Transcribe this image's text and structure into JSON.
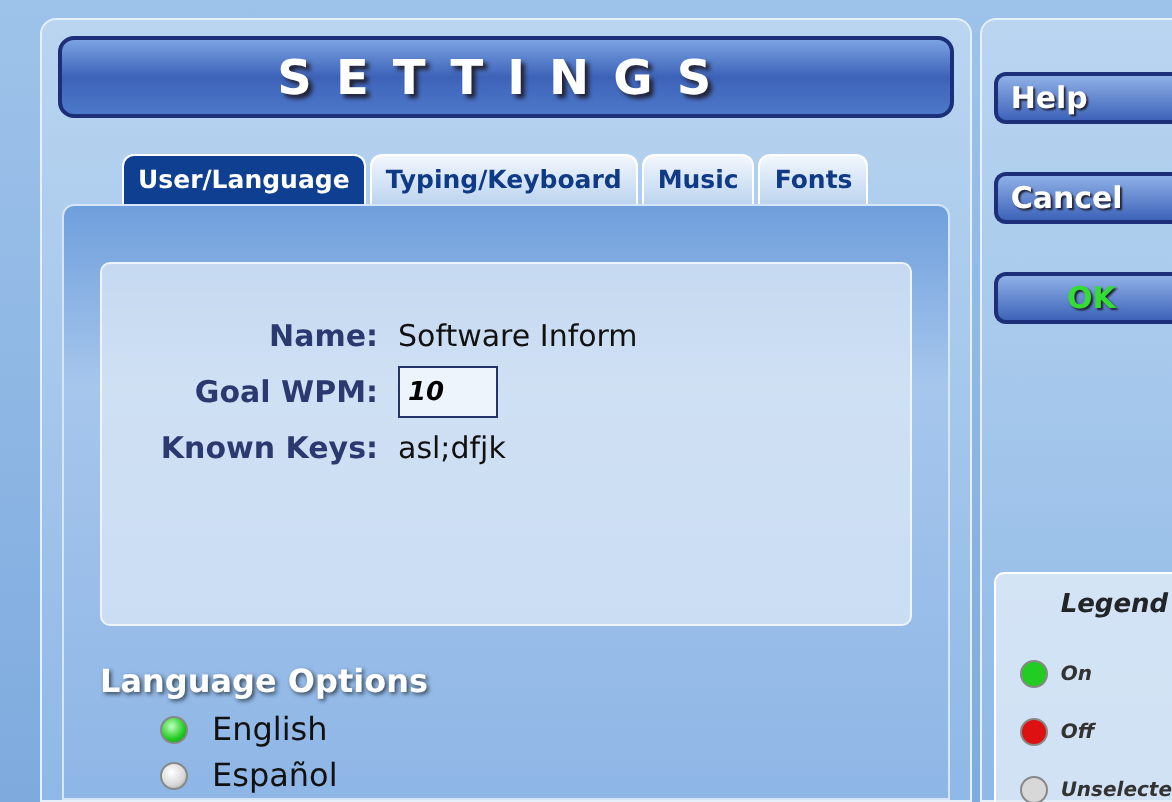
{
  "title": "SETTINGS",
  "tabs": [
    {
      "label": "User/Language",
      "selected": true
    },
    {
      "label": "Typing/Keyboard",
      "selected": false
    },
    {
      "label": "Music",
      "selected": false
    },
    {
      "label": "Fonts",
      "selected": false
    }
  ],
  "user": {
    "name_label": "Name:",
    "name": "Software Inform",
    "goal_label": "Goal WPM:",
    "goal": "10",
    "keys_label": "Known Keys:",
    "keys": "asl;dfjk"
  },
  "language_options": {
    "title": "Language Options",
    "items": [
      {
        "label": "English",
        "selected": true
      },
      {
        "label": "Español",
        "selected": false
      }
    ]
  },
  "buttons": [
    {
      "label": "Help",
      "kind": "normal"
    },
    {
      "label": "Cancel",
      "kind": "normal"
    },
    {
      "label": "OK",
      "kind": "confirm"
    }
  ],
  "legend": {
    "title": "Legend",
    "items": [
      {
        "label": "On",
        "color": "#22cc22"
      },
      {
        "label": "Off",
        "color": "#dd1111"
      },
      {
        "label": "Unselecte",
        "color": "#d8d8d8"
      }
    ]
  }
}
